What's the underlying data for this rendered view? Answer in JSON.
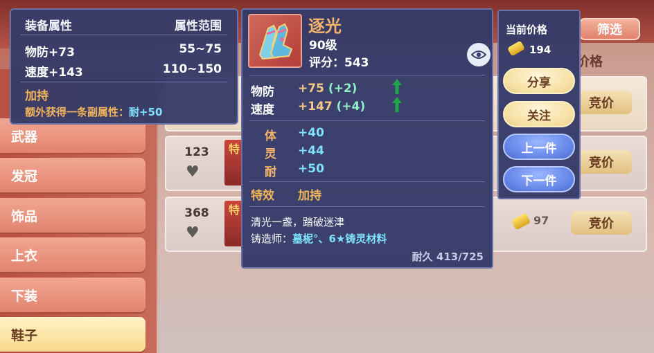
{
  "background": {
    "filter_label": "筛选",
    "price_header": "价格",
    "categories": [
      "武器",
      "发冠",
      "饰品",
      "上衣",
      "下装",
      "鞋子"
    ],
    "active_category": "鞋子",
    "rows": [
      {
        "count": "123",
        "thumb_text": "特",
        "price": "",
        "bid_label": "竞价"
      },
      {
        "count": "368",
        "thumb_text": "特",
        "price": "97",
        "bid_label": "竞价"
      }
    ],
    "top_row_bid_label": "竞价"
  },
  "attr_popup": {
    "header_left": "装备属性",
    "header_right": "属性范围",
    "stats": [
      {
        "label": "物防+73",
        "range": "55~75"
      },
      {
        "label": "速度+143",
        "range": "110~150"
      }
    ],
    "bless_title": "加持",
    "extra_text": "额外获得一条副属性：",
    "extra_value": "耐+50"
  },
  "item_card": {
    "name": "逐光",
    "level": "90级",
    "score": "评分：543",
    "main_stats": [
      {
        "label": "物防",
        "value": "+75",
        "bonus": "(+2)"
      },
      {
        "label": "速度",
        "value": "+147",
        "bonus": "(+4)"
      }
    ],
    "sub_stats": [
      {
        "label": "体",
        "value": "+40"
      },
      {
        "label": "灵",
        "value": "+44"
      },
      {
        "label": "耐",
        "value": "+50"
      }
    ],
    "effect_label": "特效",
    "effect_value": "加持",
    "description": "清光一盏，踏破迷津",
    "smith_label": "铸造师：",
    "smith_value": "墓柅°、6★铸灵材料",
    "durability": "耐久 413/725"
  },
  "side_panel": {
    "price_label": "当前价格",
    "price_value": "194",
    "buttons": {
      "share": "分享",
      "follow": "关注",
      "prev": "上一件",
      "next": "下一件"
    }
  },
  "colors": {
    "panel_bg": "#363b68",
    "panel_border": "#6a70a8",
    "accent_orange": "#f4b46a",
    "accent_cyan": "#7fe2ff",
    "accent_green": "#8ff0c8",
    "up_arrow": "#1fa64a"
  }
}
